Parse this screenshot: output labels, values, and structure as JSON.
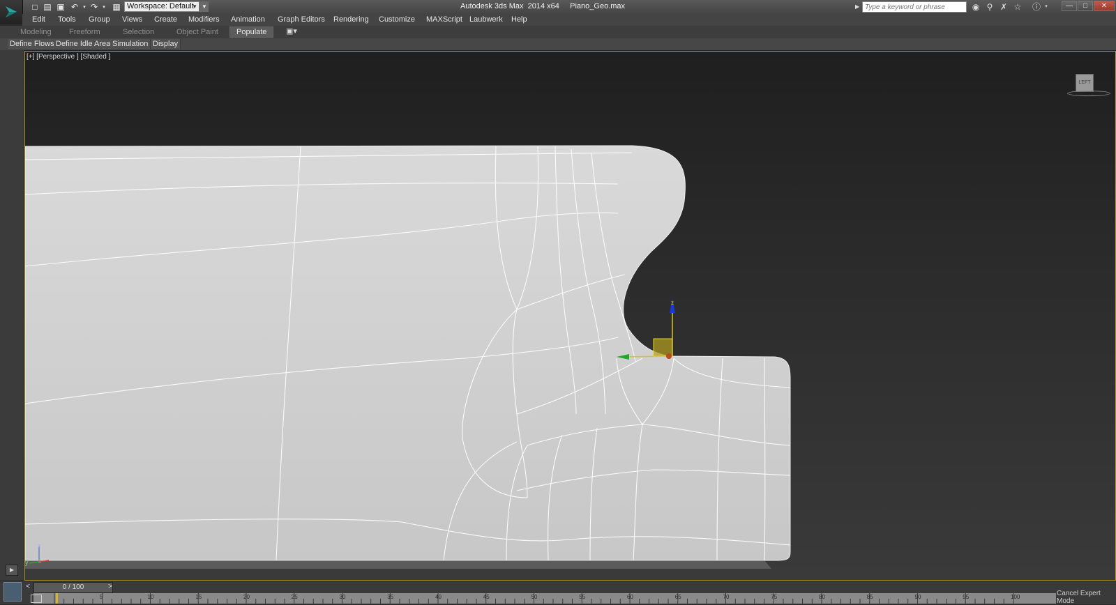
{
  "titlebar": {
    "workspace_label": "Workspace: Default",
    "app_title": "Autodesk 3ds Max  2014 x64     Piano_Geo.max",
    "search_placeholder": "Type a keyword or phrase",
    "icons": [
      "new-file-icon",
      "open-file-icon",
      "save-icon",
      "undo-icon",
      "redo-icon",
      "project-icon"
    ]
  },
  "menu": [
    "Edit",
    "Tools",
    "Group",
    "Views",
    "Create",
    "Modifiers",
    "Animation",
    "Graph Editors",
    "Rendering",
    "Customize",
    "MAXScript",
    "Laubwerk",
    "Help"
  ],
  "ribbon_tabs": [
    "Modeling",
    "Freeform",
    "Selection",
    "Object Paint",
    "Populate"
  ],
  "ribbon_active_tab": "Populate",
  "ribbon_panel": [
    "Define Flows",
    "Define Idle Areas",
    "Simulation",
    "Display"
  ],
  "viewport": {
    "label": "[+] [Perspective ] [Shaded ]",
    "viewcube_label": "LEFT",
    "gizmo_z": "z",
    "axis_z": "z",
    "axis_x": "x",
    "axis_y": "y",
    "accent_color": "#b49a22"
  },
  "timeline": {
    "frame_display": "0 / 100",
    "ticks": [
      "5",
      "10",
      "15",
      "20",
      "25",
      "30",
      "35",
      "40",
      "45",
      "50",
      "55",
      "60",
      "65",
      "70",
      "75",
      "80",
      "85",
      "90",
      "95",
      "100"
    ],
    "cancel_expert_mode": "Cancel Expert Mode"
  }
}
